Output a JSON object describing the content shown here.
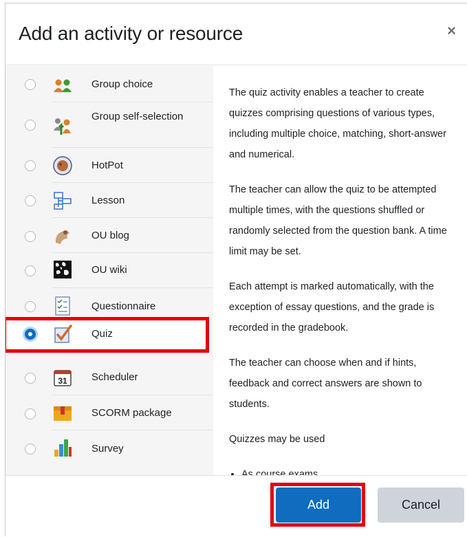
{
  "modal": {
    "title": "Add an activity or resource",
    "close_glyph": "×"
  },
  "activities": [
    {
      "label": "Group choice",
      "icon": "group-choice-icon",
      "selected": false
    },
    {
      "label": "Group self-selection",
      "icon": "group-self-selection-icon",
      "selected": false
    },
    {
      "label": "HotPot",
      "icon": "hotpot-icon",
      "selected": false
    },
    {
      "label": "Lesson",
      "icon": "lesson-icon",
      "selected": false
    },
    {
      "label": "OU blog",
      "icon": "ou-blog-icon",
      "selected": false
    },
    {
      "label": "OU wiki",
      "icon": "ou-wiki-icon",
      "selected": false
    },
    {
      "label": "Questionnaire",
      "icon": "questionnaire-icon",
      "selected": false
    },
    {
      "label": "Quiz",
      "icon": "quiz-icon",
      "selected": true
    },
    {
      "label": "Scheduler",
      "icon": "scheduler-icon",
      "selected": false
    },
    {
      "label": "SCORM package",
      "icon": "scorm-package-icon",
      "selected": false
    },
    {
      "label": "Survey",
      "icon": "survey-icon",
      "selected": false
    }
  ],
  "scheduler_icon_text": "31",
  "description": {
    "paragraphs": [
      "The quiz activity enables a teacher to create quizzes comprising questions of various types, including multiple choice, matching, short-answer and numerical.",
      "The teacher can allow the quiz to be attempted multiple times, with the questions shuffled or randomly selected from the question bank. A time limit may be set.",
      "Each attempt is marked automatically, with the exception of essay questions, and the grade is recorded in the gradebook.",
      "The teacher can choose when and if hints, feedback and correct answers are shown to students.",
      "Quizzes may be used"
    ],
    "bullets": [
      "As course exams"
    ]
  },
  "footer": {
    "add_label": "Add",
    "cancel_label": "Cancel"
  },
  "colors": {
    "primary": "#0f6cbf",
    "highlight": "#e5000b",
    "secondary_button": "#ced4da"
  }
}
